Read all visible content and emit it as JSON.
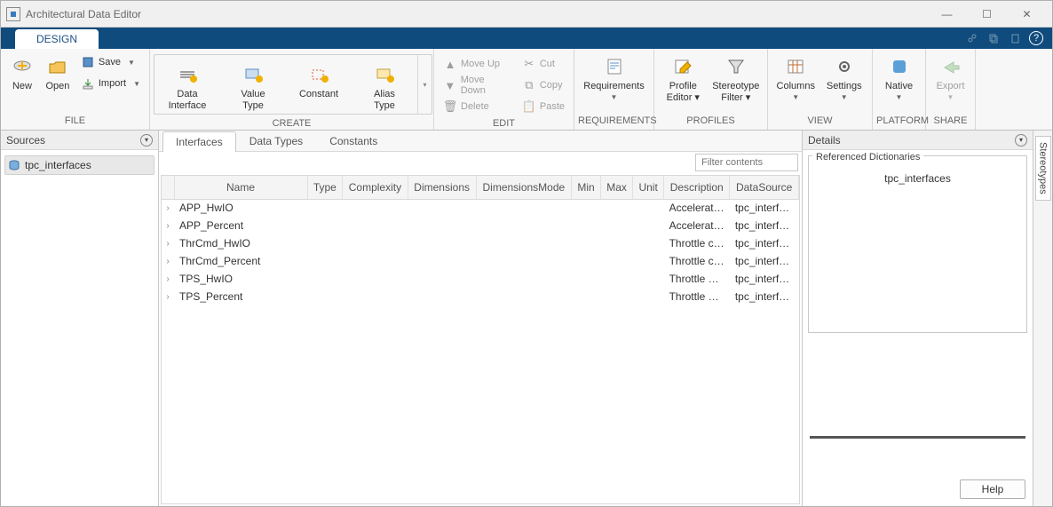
{
  "window": {
    "title": "Architectural Data Editor"
  },
  "tabstrip": {
    "design": "DESIGN"
  },
  "ribbon": {
    "file": {
      "label": "FILE",
      "new": "New",
      "open": "Open",
      "save": "Save",
      "import": "Import"
    },
    "create": {
      "label": "CREATE",
      "data_interface": "Data\nInterface",
      "value_type": "Value\nType",
      "constant": "Constant",
      "alias_type": "Alias\nType"
    },
    "edit": {
      "label": "EDIT",
      "move_up": "Move Up",
      "move_down": "Move Down",
      "delete": "Delete",
      "cut": "Cut",
      "copy": "Copy",
      "paste": "Paste"
    },
    "requirements": {
      "label": "REQUIREMENTS",
      "btn": "Requirements"
    },
    "profiles": {
      "label": "PROFILES",
      "profile_editor": "Profile\nEditor",
      "stereotype_filter": "Stereotype\nFilter"
    },
    "view": {
      "label": "VIEW",
      "columns": "Columns",
      "settings": "Settings"
    },
    "platform": {
      "label": "PLATFORM",
      "native": "Native"
    },
    "share": {
      "label": "SHARE",
      "export": "Export"
    }
  },
  "sources": {
    "header": "Sources",
    "item": "tpc_interfaces"
  },
  "subtabs": {
    "interfaces": "Interfaces",
    "data_types": "Data Types",
    "constants": "Constants"
  },
  "filter": {
    "placeholder": "Filter contents"
  },
  "columns": {
    "name": "Name",
    "type": "Type",
    "complexity": "Complexity",
    "dimensions": "Dimensions",
    "dimensions_mode": "DimensionsMode",
    "min": "Min",
    "max": "Max",
    "unit": "Unit",
    "description": "Description",
    "data_source": "DataSource"
  },
  "rows": [
    {
      "name": "APP_HwIO",
      "desc": "Accelerato...",
      "src": "tpc_interfa..."
    },
    {
      "name": "APP_Percent",
      "desc": "Accelerato...",
      "src": "tpc_interfa..."
    },
    {
      "name": "ThrCmd_HwIO",
      "desc": "Throttle co...",
      "src": "tpc_interfa..."
    },
    {
      "name": "ThrCmd_Percent",
      "desc": "Throttle co...",
      "src": "tpc_interfa..."
    },
    {
      "name": "TPS_HwIO",
      "desc": "Throttle po...",
      "src": "tpc_interfa..."
    },
    {
      "name": "TPS_Percent",
      "desc": "Throttle po...",
      "src": "tpc_interfa..."
    }
  ],
  "details": {
    "header": "Details",
    "ref_dict_label": "Referenced Dictionaries",
    "ref_dict": "tpc_interfaces",
    "help": "Help"
  },
  "sidetab": {
    "stereotypes": "Stereotypes"
  }
}
